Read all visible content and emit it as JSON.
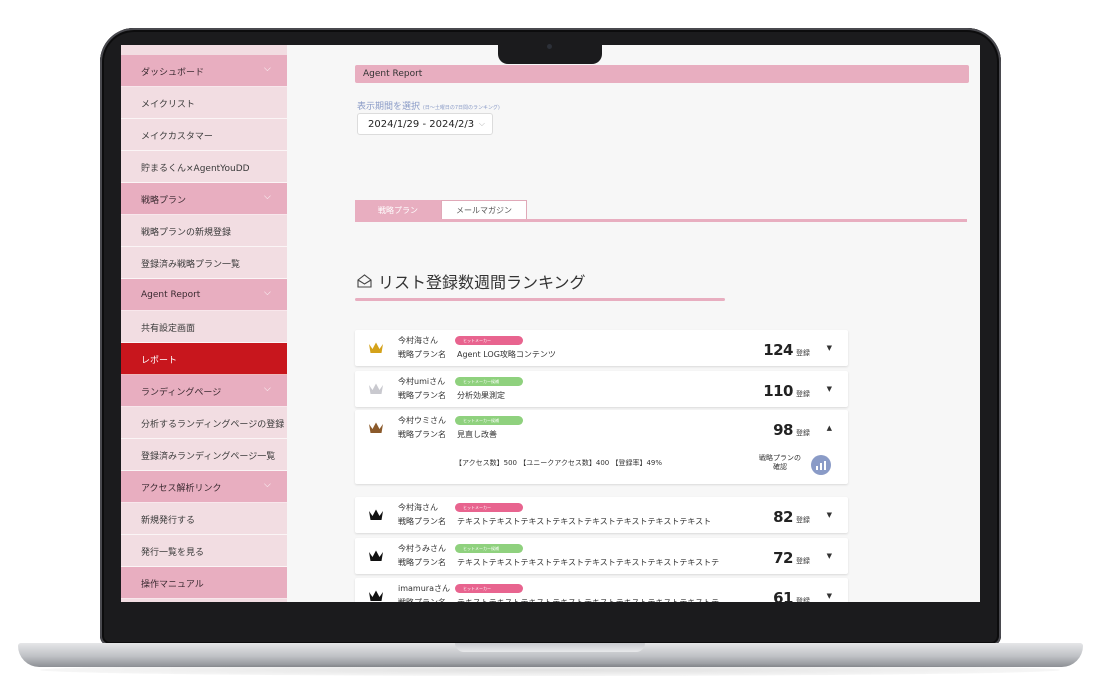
{
  "sidebar": {
    "items": [
      {
        "label": "ダッシュボード",
        "type": "section"
      },
      {
        "label": "メイクリスト",
        "type": "item"
      },
      {
        "label": "メイクカスタマー",
        "type": "item"
      },
      {
        "label": "貯まるくん×AgentYouDD",
        "type": "item"
      },
      {
        "label": "戦略プラン",
        "type": "section"
      },
      {
        "label": "戦略プランの新規登録",
        "type": "item"
      },
      {
        "label": "登録済み戦略プラン一覧",
        "type": "item"
      },
      {
        "label": "Agent  Report",
        "type": "section"
      },
      {
        "label": "共有設定画面",
        "type": "item"
      },
      {
        "label": "レポート",
        "type": "active"
      },
      {
        "label": "ランディングページ",
        "type": "section"
      },
      {
        "label": "分析するランディングページの登録",
        "type": "item"
      },
      {
        "label": "登録済みランディングページ一覧",
        "type": "item"
      },
      {
        "label": "アクセス解析リンク",
        "type": "section"
      },
      {
        "label": "新規発行する",
        "type": "item"
      },
      {
        "label": "発行一覧を見る",
        "type": "item"
      },
      {
        "label": "操作マニュアル",
        "type": "section"
      }
    ]
  },
  "header": {
    "title": "Agent Report"
  },
  "period": {
    "label": "表示期間を選択",
    "note": "(日〜土曜日の7日間のランキング)",
    "value": "2024/1/29 - 2024/2/3"
  },
  "tabs": [
    {
      "label": "戦略プラン",
      "active": true
    },
    {
      "label": "メールマガジン",
      "active": false
    }
  ],
  "ranking": {
    "title": "リスト登録数週間ランキング",
    "plan_label": "戦略プラン名",
    "unit": "登録",
    "detail_link": [
      "戦略プランの",
      "確認"
    ],
    "rows": [
      {
        "name": "今村海さん",
        "badge": "ヒットメーカー",
        "badge_color": "#e8648f",
        "plan": "Agent LOG攻略コンテンツ",
        "count": "124",
        "crown": "#d4a21a",
        "expanded": false
      },
      {
        "name": "今村umiさん",
        "badge": "ヒットメーカー候補",
        "badge_color": "#8fd17e",
        "plan": "分析効果測定",
        "count": "110",
        "crown": "#c9c9cf",
        "expanded": false
      },
      {
        "name": "今村ウミさん",
        "badge": "ヒットメーカー候補",
        "badge_color": "#8fd17e",
        "plan": "見直し改善",
        "count": "98",
        "crown": "#8b5a2b",
        "expanded": true,
        "details": "【アクセス数】500 【ユニークアクセス数】400 【登録率】49%"
      },
      {
        "name": "今村海さん",
        "badge": "ヒットメーカー",
        "badge_color": "#e8648f",
        "plan": "テキストテキストテキストテキストテキストテキストテキストテキスト",
        "count": "82",
        "crown": "#111111",
        "expanded": false
      },
      {
        "name": "今村うみさん",
        "badge": "ヒットメーカー候補",
        "badge_color": "#8fd17e",
        "plan": "テキストテキストテキストテキストテキストテキストテキストテキストテ",
        "count": "72",
        "crown": "#111111",
        "expanded": false
      },
      {
        "name": "imamuraさん",
        "badge": "ヒットメーカー",
        "badge_color": "#e8648f",
        "plan": "テキストテキストテキストテキストテキストテキストテキストテキストテ",
        "count": "61",
        "crown": "#111111",
        "expanded": false
      }
    ]
  }
}
